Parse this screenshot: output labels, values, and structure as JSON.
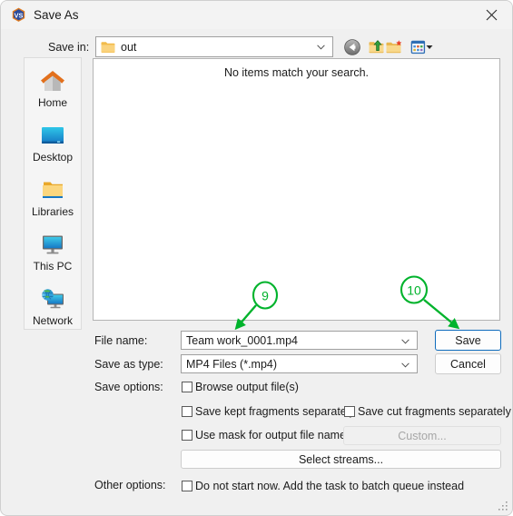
{
  "window": {
    "title": "Save As",
    "app_icon": "vs-logo-icon",
    "close_icon": "close-icon"
  },
  "toolbar": {
    "save_in_label": "Save in:",
    "current_folder": "out",
    "folder_icon": "folder-icon",
    "dropdown_icon": "chevron-down-icon",
    "buttons": [
      {
        "name": "back-button",
        "icon": "back-arrow-icon"
      },
      {
        "name": "up-one-level-button",
        "icon": "up-folder-icon"
      },
      {
        "name": "create-new-folder-button",
        "icon": "new-folder-icon"
      },
      {
        "name": "views-button",
        "icon": "views-grid-icon"
      }
    ]
  },
  "places": {
    "items": [
      {
        "label": "Home",
        "icon": "home-icon"
      },
      {
        "label": "Desktop",
        "icon": "desktop-monitor-icon"
      },
      {
        "label": "Libraries",
        "icon": "libraries-folder-icon"
      },
      {
        "label": "This PC",
        "icon": "this-pc-monitor-icon"
      },
      {
        "label": "Network",
        "icon": "network-globe-icon"
      }
    ]
  },
  "file_list": {
    "empty_message": "No items match your search."
  },
  "form": {
    "file_name_label": "File name:",
    "file_name_value": "Team work_0001.mp4",
    "save_as_type_label": "Save as type:",
    "save_as_type_value": "MP4 Files (*.mp4)",
    "save_options_label": "Save options:",
    "other_options_label": "Other options:"
  },
  "buttons": {
    "save": "Save",
    "cancel": "Cancel",
    "custom": "Custom...",
    "select_streams": "Select streams..."
  },
  "checkboxes": {
    "browse_output": "Browse output file(s)",
    "save_kept_fragments": "Save kept fragments separately",
    "save_cut_fragments": "Save cut fragments separately",
    "use_mask": "Use mask for output file names",
    "do_not_start_now": "Do not start now. Add the task to batch queue instead"
  },
  "annotations": {
    "color": "#00b32c",
    "markers": [
      {
        "number": "9",
        "target": "file-name-field"
      },
      {
        "number": "10",
        "target": "save-button"
      }
    ]
  }
}
